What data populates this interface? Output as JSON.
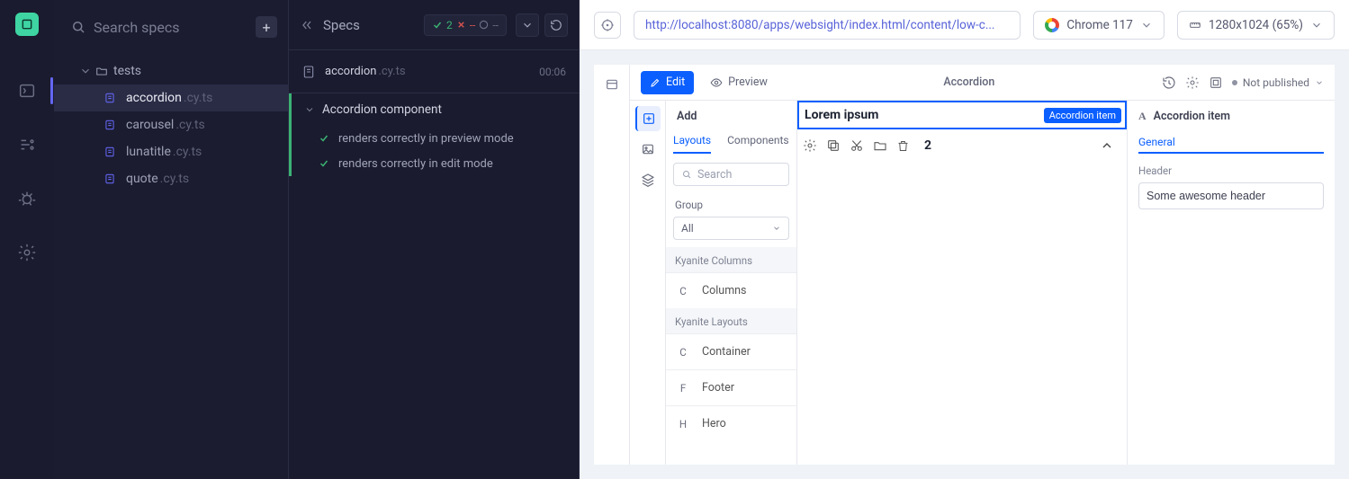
{
  "left_rail": {
    "items": [
      "code-icon",
      "runs-icon",
      "debug-icon",
      "settings-icon"
    ]
  },
  "specs_panel": {
    "search_placeholder": "Search specs",
    "folder": "tests",
    "files": [
      {
        "name": "accordion",
        "ext": ".cy.ts",
        "active": true
      },
      {
        "name": "carousel",
        "ext": ".cy.ts",
        "active": false
      },
      {
        "name": "lunatitle",
        "ext": ".cy.ts",
        "active": false
      },
      {
        "name": "quote",
        "ext": ".cy.ts",
        "active": false
      }
    ]
  },
  "reporter": {
    "header": "Specs",
    "stats": {
      "passed": "2",
      "failed": "--",
      "pending": "--"
    },
    "spec_file": {
      "name": "accordion",
      "ext": ".cy.ts",
      "duration": "00:06"
    },
    "suite": "Accordion component",
    "tests": [
      "renders correctly in preview mode",
      "renders correctly in edit mode"
    ]
  },
  "aut_bar": {
    "url": "http://localhost:8080/apps/websight/index.html/content/low-c...",
    "browser": "Chrome 117",
    "viewport": "1280x1024 (65%)"
  },
  "editor": {
    "edit_label": "Edit",
    "preview_label": "Preview",
    "page_title": "Accordion",
    "publish_status": "Not published",
    "left_panel": {
      "title": "Add",
      "tabs": [
        "Layouts",
        "Components"
      ],
      "search_placeholder": "Search",
      "group_label": "Group",
      "group_value": "All",
      "sections": [
        {
          "title": "Kyanite Columns",
          "items": [
            {
              "letter": "C",
              "label": "Columns"
            }
          ]
        },
        {
          "title": "Kyanite Layouts",
          "items": [
            {
              "letter": "C",
              "label": "Container"
            },
            {
              "letter": "F",
              "label": "Footer"
            },
            {
              "letter": "H",
              "label": "Hero"
            }
          ]
        }
      ]
    },
    "canvas": {
      "component_label": "Lorem ipsum",
      "badge": "Accordion item",
      "index": "2"
    },
    "right_panel": {
      "title": "Accordion item",
      "tab": "General",
      "field_label": "Header",
      "field_value": "Some awesome header"
    }
  }
}
